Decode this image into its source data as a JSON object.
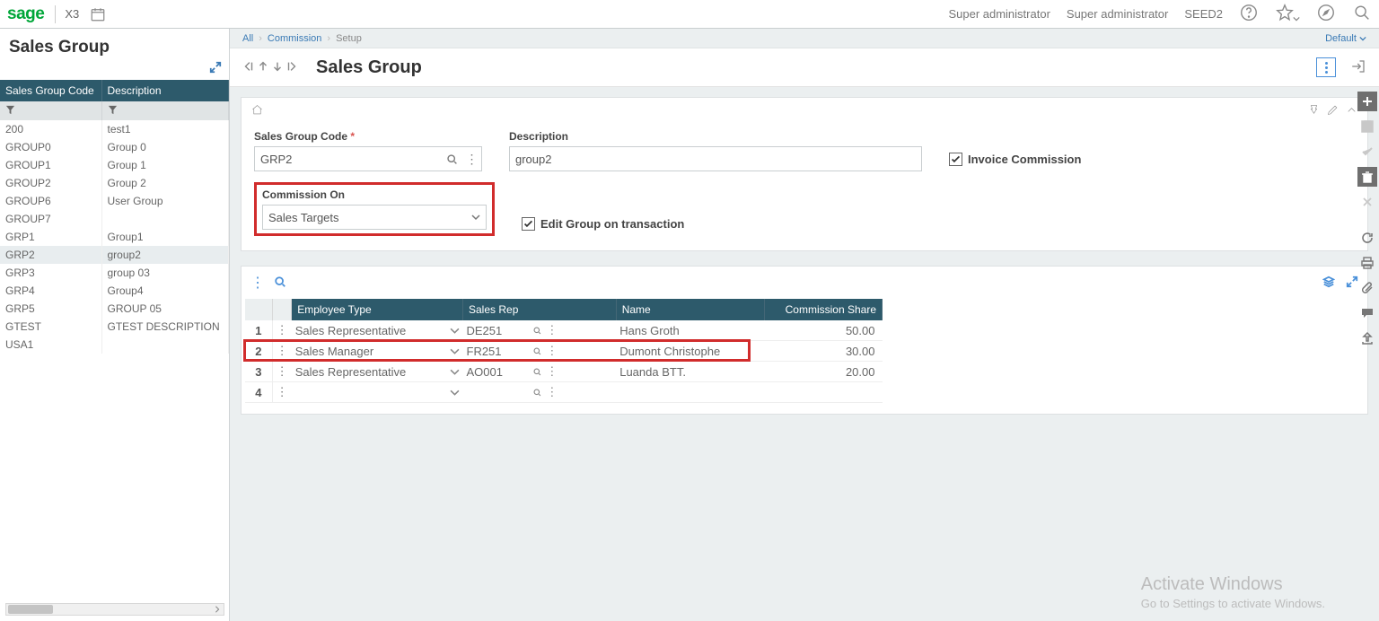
{
  "topbar": {
    "brand": "sage",
    "product": "X3",
    "user1": "Super administrator",
    "user2": "Super administrator",
    "folder": "SEED2"
  },
  "left_panel": {
    "title": "Sales Group",
    "headers": {
      "code": "Sales Group Code",
      "desc": "Description"
    },
    "rows": [
      {
        "code": "200",
        "desc": "test1"
      },
      {
        "code": "GROUP0",
        "desc": "Group 0"
      },
      {
        "code": "GROUP1",
        "desc": "Group 1"
      },
      {
        "code": "GROUP2",
        "desc": "Group 2"
      },
      {
        "code": "GROUP6",
        "desc": "User Group"
      },
      {
        "code": "GROUP7",
        "desc": ""
      },
      {
        "code": "GRP1",
        "desc": "Group1"
      },
      {
        "code": "GRP2",
        "desc": "group2"
      },
      {
        "code": "GRP3",
        "desc": "group 03"
      },
      {
        "code": "GRP4",
        "desc": "Group4"
      },
      {
        "code": "GRP5",
        "desc": "GROUP 05"
      },
      {
        "code": "GTEST",
        "desc": "GTEST DESCRIPTION"
      },
      {
        "code": "USA1",
        "desc": ""
      }
    ],
    "selected_code": "GRP2"
  },
  "breadcrumbs": {
    "all": "All",
    "commission": "Commission",
    "setup": "Setup",
    "default": "Default"
  },
  "page": {
    "title": "Sales Group"
  },
  "form": {
    "sales_group_code": {
      "label": "Sales Group Code",
      "value": "GRP2"
    },
    "description": {
      "label": "Description",
      "value": "group2"
    },
    "invoice_commission": {
      "label": "Invoice Commission",
      "checked": true
    },
    "commission_on": {
      "label": "Commission On",
      "value": "Sales Targets"
    },
    "edit_group": {
      "label": "Edit Group on transaction",
      "checked": true
    }
  },
  "grid": {
    "headers": {
      "emp_type": "Employee Type",
      "sales_rep": "Sales Rep",
      "name": "Name",
      "share": "Commission Share"
    },
    "rows": [
      {
        "n": "1",
        "emp_type": "Sales Representative",
        "sales_rep": "DE251",
        "name": "Hans Groth",
        "share": "50.00"
      },
      {
        "n": "2",
        "emp_type": "Sales Manager",
        "sales_rep": "FR251",
        "name": "Dumont Christophe",
        "share": "30.00"
      },
      {
        "n": "3",
        "emp_type": "Sales Representative",
        "sales_rep": "AO001",
        "name": "Luanda BTT.",
        "share": "20.00"
      },
      {
        "n": "4",
        "emp_type": "",
        "sales_rep": "",
        "name": "",
        "share": ""
      }
    ],
    "highlight_row": 1
  },
  "watermark": {
    "t1": "Activate Windows",
    "t2": "Go to Settings to activate Windows."
  }
}
